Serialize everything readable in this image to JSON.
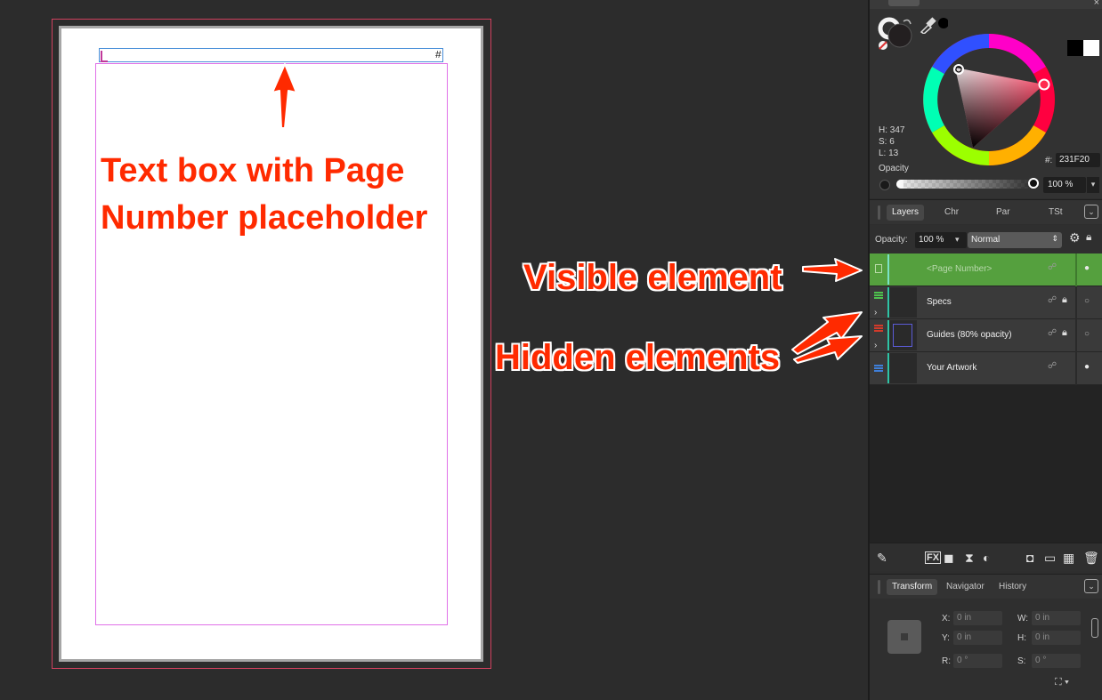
{
  "document": {
    "page_number_placeholder": "#"
  },
  "annotations": {
    "textbox": "Text box with Page Number placeholder",
    "visible": "Visible element",
    "hidden": "Hidden elements"
  },
  "color_panel": {
    "h": "H: 347",
    "s": "S: 6",
    "l": "L: 13",
    "opacity_label": "Opacity",
    "hex_label": "#:",
    "hex_value": "231F20",
    "opacity_value": "100 %",
    "colors": {
      "hue": "#ff2a4f",
      "fill": "#231f20"
    }
  },
  "tabs": {
    "layers": "Layers",
    "chr": "Chr",
    "par": "Par",
    "tst": "TSt"
  },
  "layer_toolbar": {
    "opacity_label": "Opacity:",
    "opacity_value": "100 %",
    "blend_mode": "Normal"
  },
  "layers": [
    {
      "name": "<Page Number>",
      "selected": true,
      "locked": false,
      "visible": true,
      "tag_color": "#7fbf6a"
    },
    {
      "name": "Specs",
      "selected": false,
      "locked": true,
      "visible": false,
      "tag_color": "#4ec24e"
    },
    {
      "name": "Guides (80% opacity)",
      "selected": false,
      "locked": true,
      "visible": false,
      "tag_color": "#d23b2b"
    },
    {
      "name": "Your Artwork",
      "selected": false,
      "locked": false,
      "visible": true,
      "tag_color": "#3f7fd9"
    }
  ],
  "transform_tabs": {
    "transform": "Transform",
    "navigator": "Navigator",
    "history": "History"
  },
  "transform": {
    "x_label": "X:",
    "x_value": "0 in",
    "y_label": "Y:",
    "y_value": "0 in",
    "w_label": "W:",
    "w_value": "0 in",
    "h_label": "H:",
    "h_value": "0 in",
    "r_label": "R:",
    "r_value": "0 °",
    "s_label": "S:",
    "s_value": "0 °"
  }
}
